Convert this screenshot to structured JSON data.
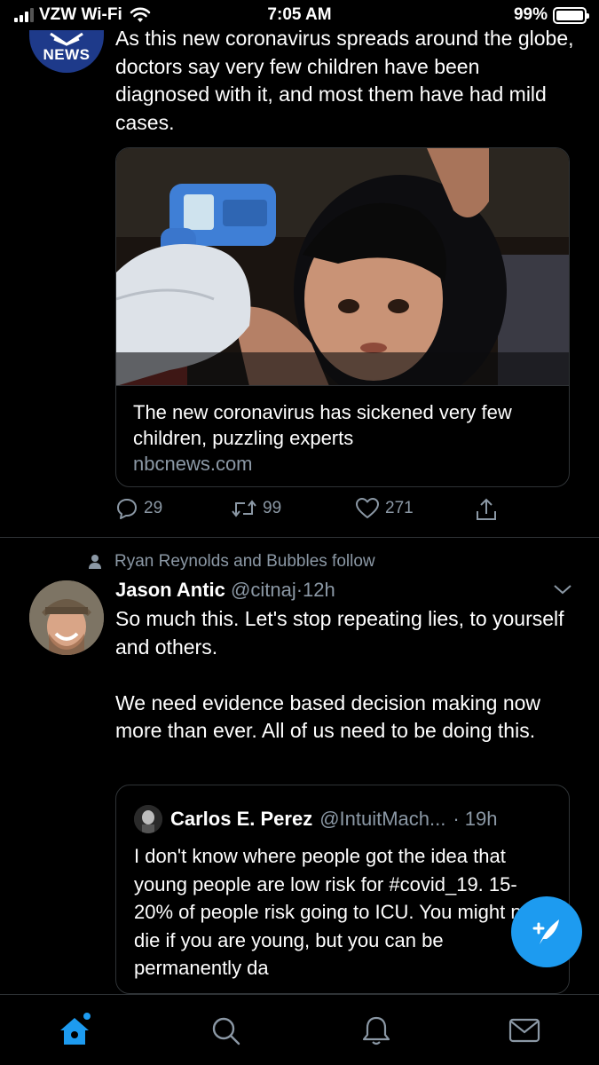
{
  "status_bar": {
    "carrier": "VZW Wi-Fi",
    "time": "7:05 AM",
    "battery": "99%",
    "battery_level": 0.99,
    "signal_bars": 3
  },
  "tweet1": {
    "avatar_label": "NEWS",
    "text": "As this new coronavirus spreads around the globe, doctors say very few children have been diagnosed with it, and most them have had mild cases.",
    "card": {
      "title": "The new coronavirus has sickened very few children, puzzling experts",
      "domain": "nbcnews.com"
    },
    "actions": {
      "replies": "29",
      "retweets": "99",
      "likes": "271"
    }
  },
  "tweet2": {
    "social_context": "Ryan Reynolds and Bubbles follow",
    "name": "Jason Antic",
    "handle": "@citnaj",
    "dot": "·",
    "time": "12h",
    "text": "So much this.  Let's stop repeating lies, to yourself and others.\n\nWe need evidence based decision making now more than ever.  All of us need to be doing this.",
    "quote": {
      "name": "Carlos E. Perez",
      "handle": "@IntuitMach...",
      "time": "· 19h",
      "text": "I don't know where people got the idea that young people are low risk for #covid_19.  15-20% of people risk going to ICU.  You might now die if you are young, but you can be permanently da"
    }
  },
  "colors": {
    "accent": "#1d9bf0",
    "muted": "#8b98a5",
    "border": "#2f3336",
    "background": "#000000"
  },
  "tabs": [
    {
      "icon": "home-icon",
      "active": true
    },
    {
      "icon": "search-icon",
      "active": false
    },
    {
      "icon": "notifications-icon",
      "active": false
    },
    {
      "icon": "messages-icon",
      "active": false
    }
  ]
}
